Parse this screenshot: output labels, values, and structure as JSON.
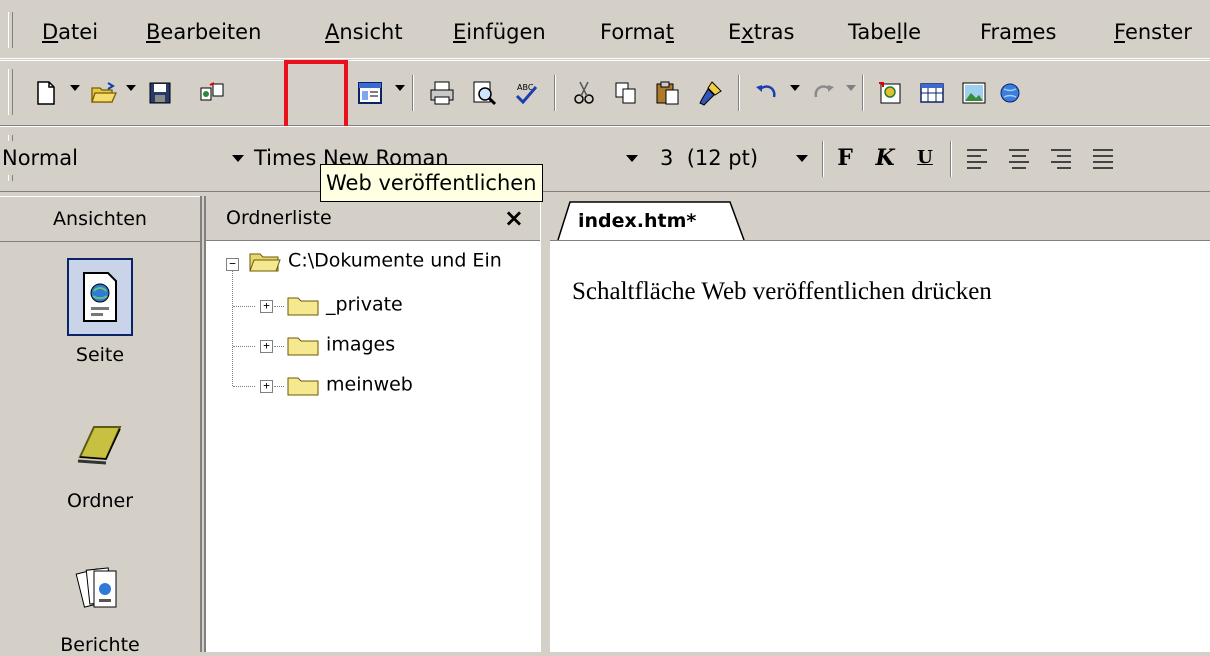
{
  "menubar": {
    "items": [
      {
        "pre": "",
        "u": "D",
        "post": "atei"
      },
      {
        "pre": "",
        "u": "B",
        "post": "earbeiten"
      },
      {
        "pre": "",
        "u": "A",
        "post": "nsicht"
      },
      {
        "pre": "",
        "u": "E",
        "post": "infügen"
      },
      {
        "pre": "Forma",
        "u": "t",
        "post": ""
      },
      {
        "pre": "E",
        "u": "x",
        "post": "tras"
      },
      {
        "pre": "Tabe",
        "u": "l",
        "post": "le"
      },
      {
        "pre": "Fra",
        "u": "m",
        "post": "es"
      },
      {
        "pre": "",
        "u": "F",
        "post": "enster"
      }
    ]
  },
  "toolbar": {
    "icons": [
      "new-page-icon",
      "open-folder-icon",
      "save-icon",
      "publish-files-icon",
      "publish-web-icon",
      "web-component-icon",
      "print-icon",
      "preview-icon",
      "spelling-icon",
      "cut-icon",
      "copy-icon",
      "paste-icon",
      "format-painter-icon",
      "undo-icon",
      "redo-icon",
      "insert-component-icon",
      "insert-table-icon",
      "insert-picture-icon",
      "hyperlink-icon"
    ],
    "highlight_color": "#e8101a"
  },
  "formatbar": {
    "style": "Normal",
    "font": "Times New Roman",
    "size": "3  (12 pt)",
    "bold": "F",
    "italic": "K",
    "underline": "U"
  },
  "tooltip": "Web veröffentlichen",
  "views": {
    "header": "Ansichten",
    "items": [
      {
        "label": "Seite",
        "icon": "page-view-icon"
      },
      {
        "label": "Ordner",
        "icon": "folder-view-icon"
      },
      {
        "label": "Berichte",
        "icon": "reports-view-icon"
      }
    ]
  },
  "folders": {
    "header": "Ordnerliste",
    "close": "×",
    "root": "C:\\Dokumente und Ein",
    "children": [
      "_private",
      "images",
      "meinweb"
    ]
  },
  "editor": {
    "tab": "index.htm*",
    "text": "Schaltfläche Web veröffentlichen drücken"
  }
}
